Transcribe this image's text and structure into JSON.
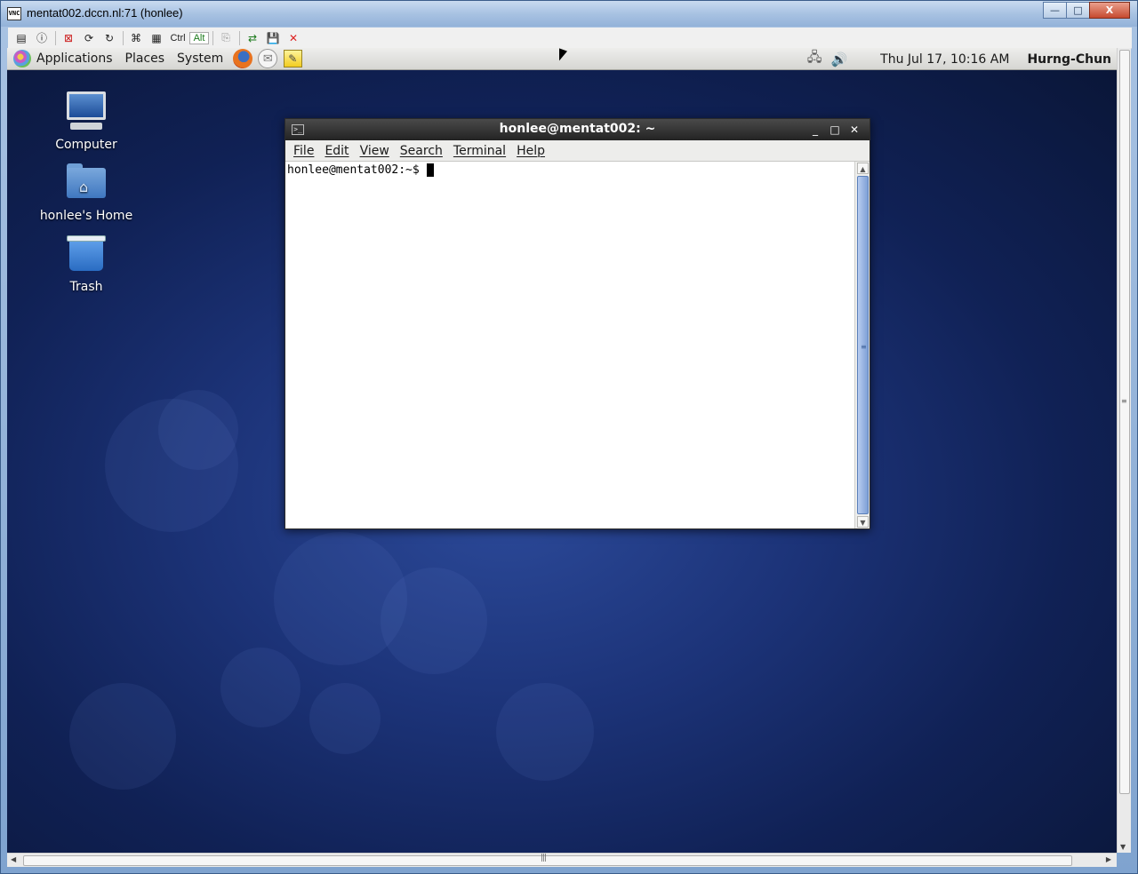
{
  "vnc": {
    "title": "mentat002.dccn.nl:71 (honlee)",
    "title_icon": "vnc-icon",
    "window_buttons": {
      "minimize": "—",
      "maximize": "□",
      "close": "X"
    },
    "toolbar": {
      "ctrl_label": "Ctrl",
      "alt_label": "Alt",
      "icons": [
        "options-icon",
        "info-icon",
        "fullscreen-icon",
        "refresh-icon",
        "refresh-alt-icon",
        "ctrl-alt-del-icon",
        "file-transfer-icon",
        "copy-icon",
        "send-icon",
        "save-icon",
        "disconnect-icon"
      ]
    }
  },
  "panel": {
    "menus": [
      "Applications",
      "Places",
      "System"
    ],
    "clock": "Thu Jul 17, 10:16 AM",
    "user": "Hurng-Chun"
  },
  "desktop": {
    "icons": [
      {
        "label": "Computer",
        "icon": "computer-icon"
      },
      {
        "label": "honlee's Home",
        "icon": "home-folder-icon"
      },
      {
        "label": "Trash",
        "icon": "trash-icon"
      }
    ]
  },
  "terminal": {
    "title": "honlee@mentat002: ~",
    "menus": [
      "File",
      "Edit",
      "View",
      "Search",
      "Terminal",
      "Help"
    ],
    "prompt": "honlee@mentat002:~$ "
  }
}
